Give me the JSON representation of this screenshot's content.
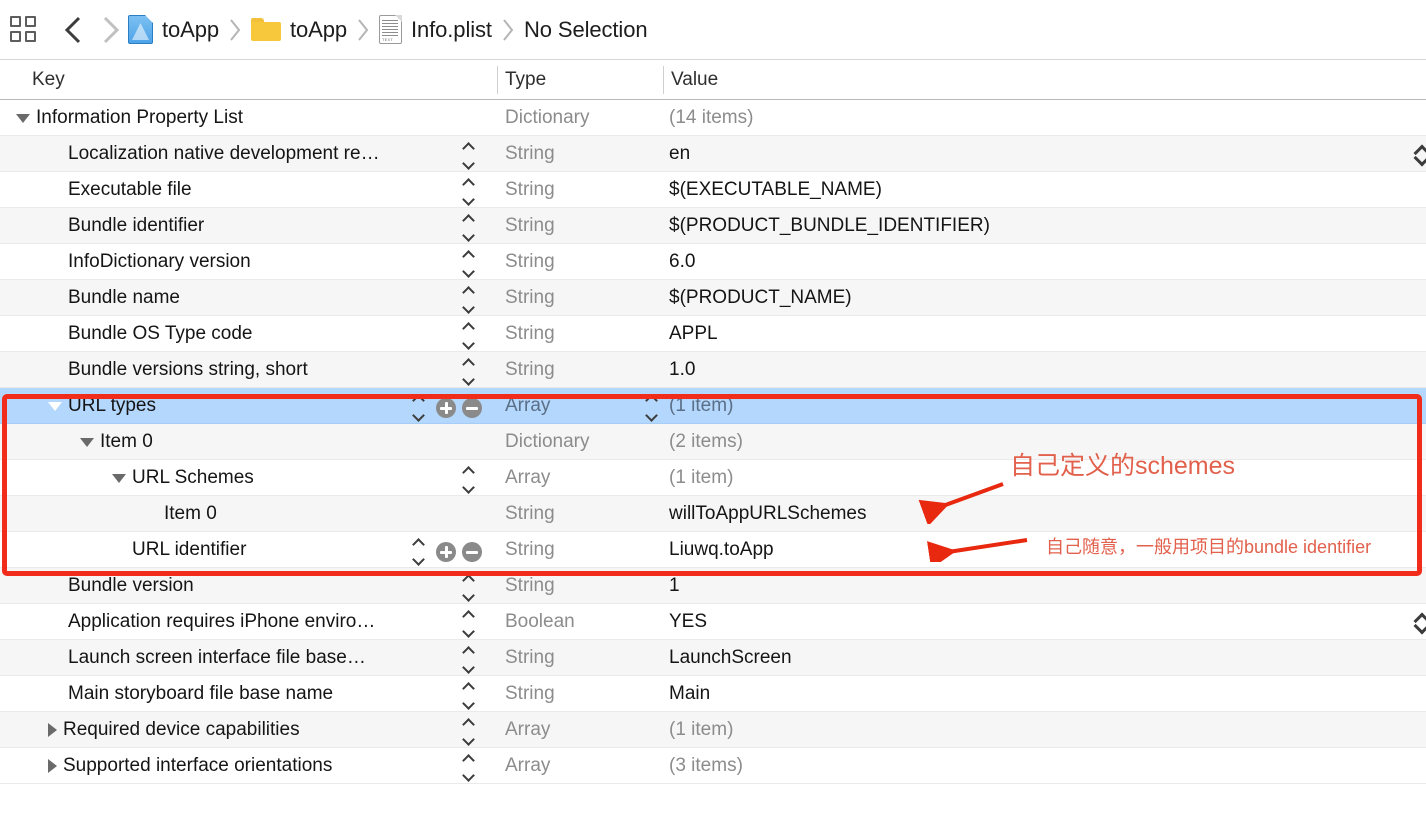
{
  "window": {
    "jumpbar": {
      "grid_icon": "grid-icon",
      "back_icon": "chevron-left-icon",
      "forward_icon": "chevron-right-icon",
      "breadcrumbs": [
        {
          "icon": "xcode-project-icon",
          "label": "toApp"
        },
        {
          "icon": "folder-icon",
          "label": "toApp"
        },
        {
          "icon": "plist-document-icon",
          "label": "Info.plist"
        },
        {
          "icon": "",
          "label": "No Selection"
        }
      ]
    }
  },
  "table": {
    "columns": {
      "key": "Key",
      "type": "Type",
      "value": "Value"
    },
    "rows": [
      {
        "key": "Information Property List",
        "type": "Dictionary",
        "value": "(14 items)",
        "indent": 0,
        "disclosure": "down",
        "type_muted": true,
        "value_muted": true,
        "stepper": false,
        "addremove": false,
        "value_stepper": false,
        "selected": false,
        "edge_chevron": false
      },
      {
        "key": "Localization native development re…",
        "type": "String",
        "value": "en",
        "indent": 1,
        "disclosure": "none",
        "type_muted": true,
        "value_muted": false,
        "stepper": true,
        "addremove": false,
        "value_stepper": false,
        "selected": false,
        "edge_chevron": true
      },
      {
        "key": "Executable file",
        "type": "String",
        "value": "$(EXECUTABLE_NAME)",
        "indent": 1,
        "disclosure": "none",
        "type_muted": true,
        "value_muted": false,
        "stepper": true,
        "addremove": false,
        "value_stepper": false,
        "selected": false,
        "edge_chevron": false
      },
      {
        "key": "Bundle identifier",
        "type": "String",
        "value": "$(PRODUCT_BUNDLE_IDENTIFIER)",
        "indent": 1,
        "disclosure": "none",
        "type_muted": true,
        "value_muted": false,
        "stepper": true,
        "addremove": false,
        "value_stepper": false,
        "selected": false,
        "edge_chevron": false
      },
      {
        "key": "InfoDictionary version",
        "type": "String",
        "value": "6.0",
        "indent": 1,
        "disclosure": "none",
        "type_muted": true,
        "value_muted": false,
        "stepper": true,
        "addremove": false,
        "value_stepper": false,
        "selected": false,
        "edge_chevron": false
      },
      {
        "key": "Bundle name",
        "type": "String",
        "value": "$(PRODUCT_NAME)",
        "indent": 1,
        "disclosure": "none",
        "type_muted": true,
        "value_muted": false,
        "stepper": true,
        "addremove": false,
        "value_stepper": false,
        "selected": false,
        "edge_chevron": false
      },
      {
        "key": "Bundle OS Type code",
        "type": "String",
        "value": "APPL",
        "indent": 1,
        "disclosure": "none",
        "type_muted": true,
        "value_muted": false,
        "stepper": true,
        "addremove": false,
        "value_stepper": false,
        "selected": false,
        "edge_chevron": false
      },
      {
        "key": "Bundle versions string, short",
        "type": "String",
        "value": "1.0",
        "indent": 1,
        "disclosure": "none",
        "type_muted": true,
        "value_muted": false,
        "stepper": true,
        "addremove": false,
        "value_stepper": false,
        "selected": false,
        "edge_chevron": false
      },
      {
        "key": "URL types",
        "type": "Array",
        "value": "(1 item)",
        "indent": 1,
        "disclosure": "down",
        "type_muted": true,
        "value_muted": true,
        "stepper": true,
        "addremove": true,
        "value_stepper": true,
        "selected": true,
        "edge_chevron": false
      },
      {
        "key": "Item 0",
        "type": "Dictionary",
        "value": "(2 items)",
        "indent": 2,
        "disclosure": "down",
        "type_muted": true,
        "value_muted": true,
        "stepper": false,
        "addremove": false,
        "value_stepper": false,
        "selected": false,
        "edge_chevron": false
      },
      {
        "key": "URL Schemes",
        "type": "Array",
        "value": "(1 item)",
        "indent": 3,
        "disclosure": "down",
        "type_muted": true,
        "value_muted": true,
        "stepper": true,
        "addremove": false,
        "value_stepper": false,
        "selected": false,
        "edge_chevron": false
      },
      {
        "key": "Item 0",
        "type": "String",
        "value": "willToAppURLSchemes",
        "indent": 4,
        "disclosure": "none",
        "type_muted": true,
        "value_muted": false,
        "stepper": false,
        "addremove": false,
        "value_stepper": false,
        "selected": false,
        "edge_chevron": false
      },
      {
        "key": "URL identifier",
        "type": "String",
        "value": "Liuwq.toApp",
        "indent": 3,
        "disclosure": "none",
        "type_muted": true,
        "value_muted": false,
        "stepper": true,
        "addremove": true,
        "value_stepper": false,
        "selected": false,
        "edge_chevron": false
      },
      {
        "key": "Bundle version",
        "type": "String",
        "value": "1",
        "indent": 1,
        "disclosure": "none",
        "type_muted": true,
        "value_muted": false,
        "stepper": true,
        "addremove": false,
        "value_stepper": false,
        "selected": false,
        "edge_chevron": false
      },
      {
        "key": "Application requires iPhone enviro…",
        "type": "Boolean",
        "value": "YES",
        "indent": 1,
        "disclosure": "none",
        "type_muted": true,
        "value_muted": false,
        "stepper": true,
        "addremove": false,
        "value_stepper": false,
        "selected": false,
        "edge_chevron": true
      },
      {
        "key": "Launch screen interface file base…",
        "type": "String",
        "value": "LaunchScreen",
        "indent": 1,
        "disclosure": "none",
        "type_muted": true,
        "value_muted": false,
        "stepper": true,
        "addremove": false,
        "value_stepper": false,
        "selected": false,
        "edge_chevron": false
      },
      {
        "key": "Main storyboard file base name",
        "type": "String",
        "value": "Main",
        "indent": 1,
        "disclosure": "none",
        "type_muted": true,
        "value_muted": false,
        "stepper": true,
        "addremove": false,
        "value_stepper": false,
        "selected": false,
        "edge_chevron": false
      },
      {
        "key": "Required device capabilities",
        "type": "Array",
        "value": "(1 item)",
        "indent": 1,
        "disclosure": "right",
        "type_muted": true,
        "value_muted": true,
        "stepper": true,
        "addremove": false,
        "value_stepper": false,
        "selected": false,
        "edge_chevron": false
      },
      {
        "key": "Supported interface orientations",
        "type": "Array",
        "value": "(3 items)",
        "indent": 1,
        "disclosure": "right",
        "type_muted": true,
        "value_muted": true,
        "stepper": true,
        "addremove": false,
        "value_stepper": false,
        "selected": false,
        "edge_chevron": false
      }
    ]
  },
  "annotations": {
    "highlight_color": "#f22c1b",
    "text_color": "#e2614c",
    "schemes_note": "自己定义的schemes",
    "identifier_note": "自己随意，一般用项目的bundle identifier"
  }
}
